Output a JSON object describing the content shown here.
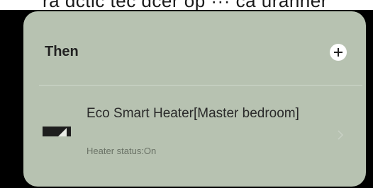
{
  "top_text": "ra dctic tec dcer op ··· ca uranner",
  "rule": {
    "then_title": "Then",
    "actions": [
      {
        "device_name": "Eco Smart Heater[Master bedroom]",
        "status": "Heater status:On"
      }
    ]
  },
  "icons": {
    "add": "plus-icon",
    "device": "heater-icon",
    "chevron": "chevron-right-icon"
  },
  "colors": {
    "card_background": "#b7c2b1",
    "page_background": "#000000"
  }
}
